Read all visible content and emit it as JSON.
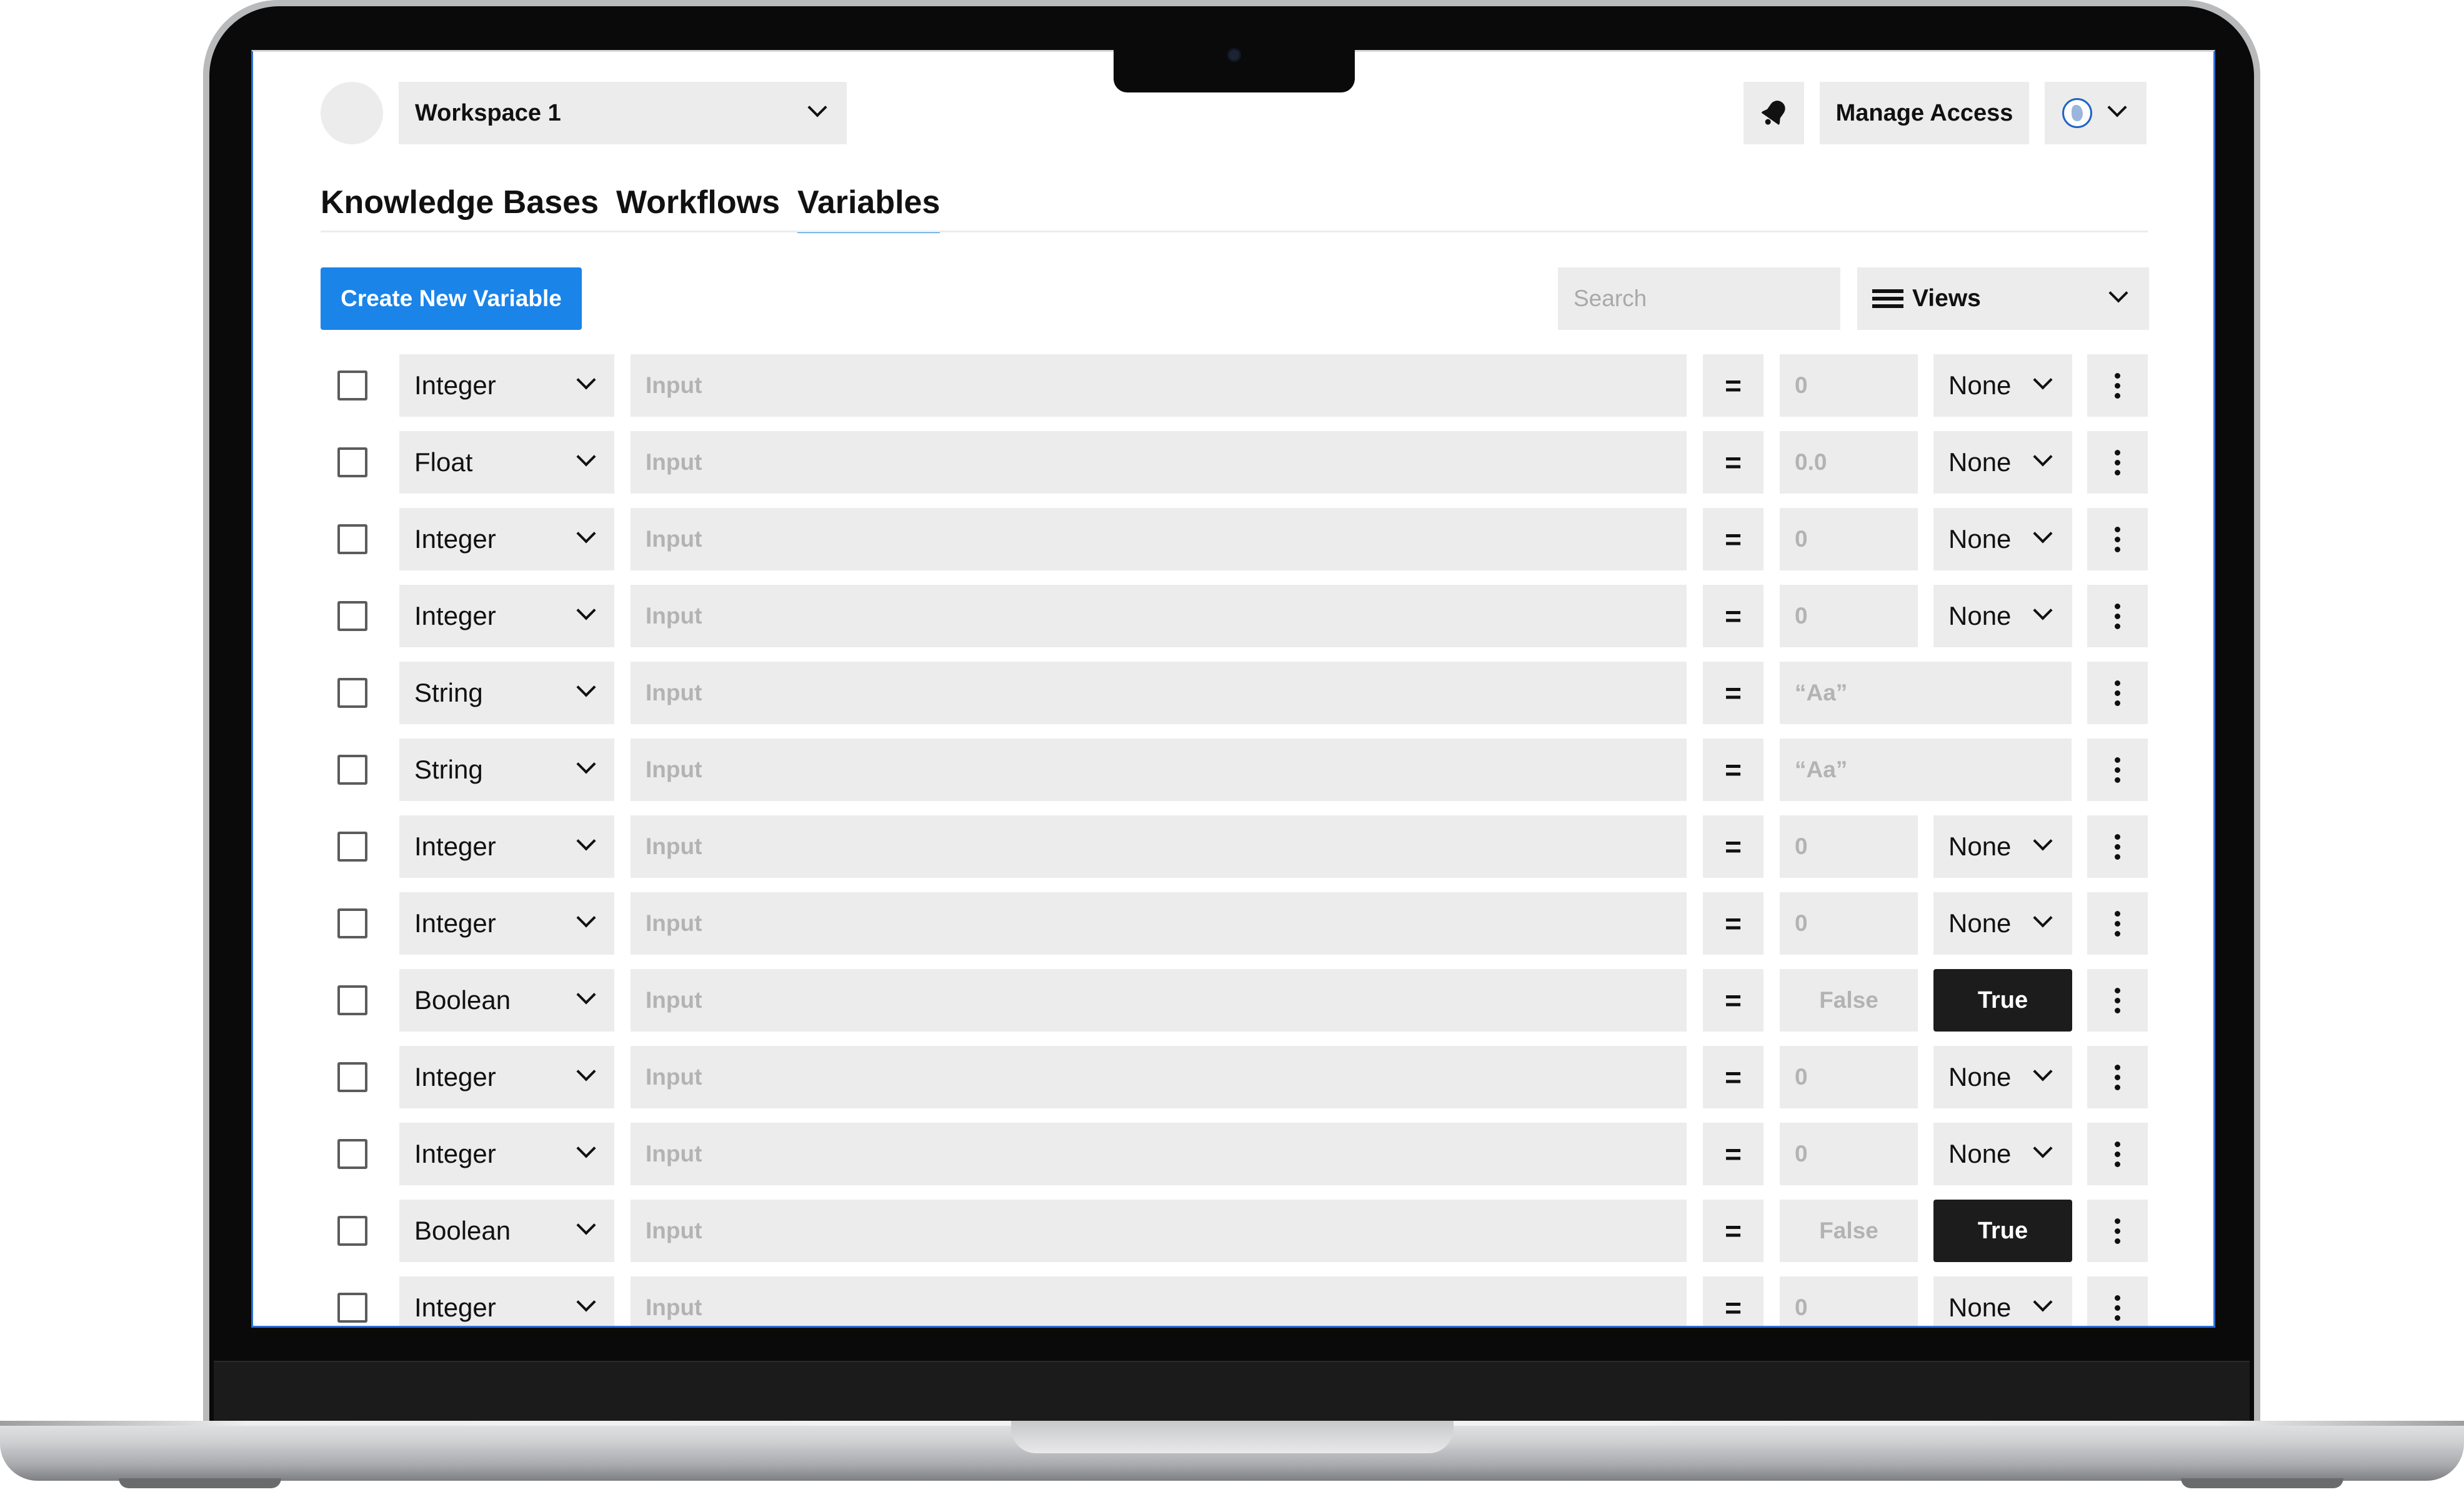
{
  "header": {
    "workspace_label": "Workspace 1",
    "bell_icon": "bell-icon",
    "manage_access_label": "Manage Access",
    "user_icon": "globe-avatar-icon"
  },
  "tabs": [
    {
      "label": "Knowledge Bases",
      "active": false
    },
    {
      "label": "Workflows",
      "active": false
    },
    {
      "label": "Variables",
      "active": true
    }
  ],
  "toolbar": {
    "create_label": "Create New Variable",
    "search_placeholder": "Search",
    "views_label": "Views"
  },
  "colors": {
    "accent": "#1a84e9",
    "field_bg": "#ececec",
    "true_button_bg": "#1c1c1c"
  },
  "rows": [
    {
      "type": "Integer",
      "name_placeholder": "Input",
      "equals": "=",
      "value": "0",
      "unit": "None"
    },
    {
      "type": "Float",
      "name_placeholder": "Input",
      "equals": "=",
      "value": "0.0",
      "unit": "None"
    },
    {
      "type": "Integer",
      "name_placeholder": "Input",
      "equals": "=",
      "value": "0",
      "unit": "None"
    },
    {
      "type": "Integer",
      "name_placeholder": "Input",
      "equals": "=",
      "value": "0",
      "unit": "None"
    },
    {
      "type": "String",
      "name_placeholder": "Input",
      "equals": "=",
      "value": "“Aa”"
    },
    {
      "type": "String",
      "name_placeholder": "Input",
      "equals": "=",
      "value": "“Aa”"
    },
    {
      "type": "Integer",
      "name_placeholder": "Input",
      "equals": "=",
      "value": "0",
      "unit": "None"
    },
    {
      "type": "Integer",
      "name_placeholder": "Input",
      "equals": "=",
      "value": "0",
      "unit": "None"
    },
    {
      "type": "Boolean",
      "name_placeholder": "Input",
      "equals": "=",
      "value": "False",
      "toggle": "True"
    },
    {
      "type": "Integer",
      "name_placeholder": "Input",
      "equals": "=",
      "value": "0",
      "unit": "None"
    },
    {
      "type": "Integer",
      "name_placeholder": "Input",
      "equals": "=",
      "value": "0",
      "unit": "None"
    },
    {
      "type": "Boolean",
      "name_placeholder": "Input",
      "equals": "=",
      "value": "False",
      "toggle": "True"
    },
    {
      "type": "Integer",
      "name_placeholder": "Input",
      "equals": "=",
      "value": "0",
      "unit": "None"
    }
  ]
}
